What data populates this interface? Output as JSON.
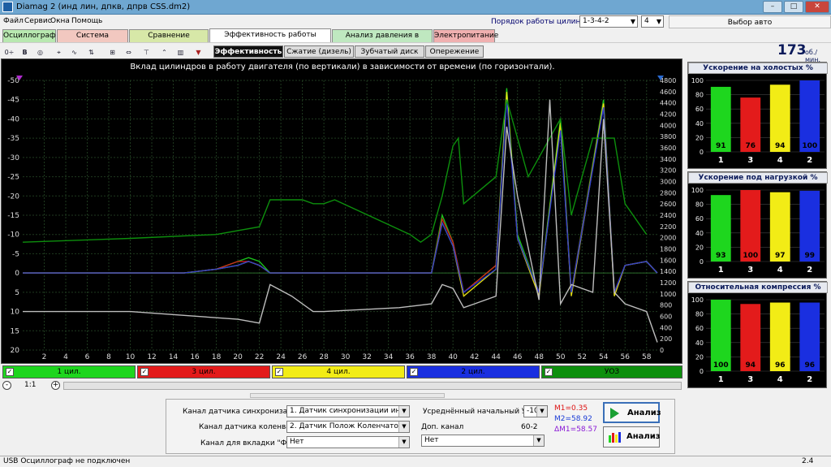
{
  "window": {
    "title": "Diamag 2 (инд лин, дпкв, дпрв CSS.dm2)"
  },
  "menu": [
    "Файл",
    "Сервис",
    "Окна",
    "Помощь"
  ],
  "header": {
    "cyl_order_label": "Порядок работы цилиндров",
    "cyl_order_value": "1-3-4-2",
    "cyl_count": "4",
    "select_car": "Выбор авто"
  },
  "tabs": [
    "Осциллограф",
    "Система зажигания",
    "Сравнение цилиндров",
    "Эффективность работы цилиндров",
    "Анализ давления в цилиндре",
    "Электропитание"
  ],
  "tab_colors": [
    "#b8e8b0",
    "#f2c8c0",
    "#d7e8a8",
    "#ffffff",
    "#bfe8c0",
    "#f0b0b0"
  ],
  "toolbar_icons": [
    "settings-icon",
    "bold-b-icon",
    "rpm-icon",
    "zoom-cursor-icon",
    "curve-icon",
    "sort-icon",
    "grid-icon",
    "scale-icon",
    "marker-icon",
    "peak-icon",
    "chart-icon",
    "filter-icon"
  ],
  "subtabs": [
    "Эффективность",
    "Сжатие (дизель)",
    "Зубчатый диск",
    "Опережение"
  ],
  "rpm": {
    "value": "173",
    "unit": "об./мин."
  },
  "scope": {
    "title": "Вклад цилиндров в работу двигателя (по вертикали) в зависимости от времени (по горизонтали)."
  },
  "cylinders": [
    {
      "label": "1 цил.",
      "color": "#1ed61e"
    },
    {
      "label": "3 цил.",
      "color": "#e31b1b"
    },
    {
      "label": "4 цил.",
      "color": "#f2ec16"
    },
    {
      "label": "2 цил.",
      "color": "#1a2fe0"
    },
    {
      "label": "УОЗ",
      "color": "#0d8f0d"
    }
  ],
  "zoom": {
    "minus": "-",
    "value": "1:1",
    "plus": "+"
  },
  "settings": {
    "sync_label": "Канал датчика синхронизации",
    "sync_value": "1. Датчик синхронизации инд. лин",
    "crank_label": "Канал датчика коленвала",
    "crank_value": "2. Датчик Полож Коленчатого Вал",
    "phase_label": "Канал для вкладки \"Фаза\"",
    "phase_value": "Нет",
    "uoz_label": "Усреднённый начальный УОЗ",
    "uoz_value": "-10",
    "add_label": "Доп. канал",
    "add_value": "Нет",
    "disc": "60-2",
    "m1": "M1=0.35",
    "m2": "M2=58.92",
    "dm": "ΔM1=58.57"
  },
  "buttons": {
    "analyze1": "Анализ",
    "analyze2": "Анализ"
  },
  "status": {
    "text": "USB Осциллограф не подключен",
    "version": "2.4"
  },
  "chart_data": [
    {
      "type": "line",
      "title": "Вклад цилиндров в работу двигателя (по вертикали) в зависимости от времени (по горизонтали).",
      "x_ticks": [
        2,
        4,
        6,
        8,
        10,
        12,
        14,
        16,
        18,
        20,
        22,
        24,
        26,
        28,
        30,
        32,
        34,
        36,
        38,
        40,
        42,
        44,
        46,
        48,
        50,
        52,
        54,
        56,
        58
      ],
      "x_range": [
        0,
        59
      ],
      "y_left_range": [
        -50,
        20
      ],
      "y_left_ticks": [
        -50,
        -45,
        -40,
        -35,
        -30,
        -25,
        -20,
        -15,
        -10,
        -5,
        0,
        5,
        10,
        15,
        20
      ],
      "y_right_range": [
        0,
        4800
      ],
      "y_right_ticks": [
        0,
        200,
        400,
        600,
        800,
        1000,
        1200,
        1400,
        1600,
        1800,
        2000,
        2200,
        2400,
        2600,
        2800,
        3000,
        3200,
        3400,
        3600,
        3800,
        4000,
        4200,
        4400,
        4600,
        4800
      ],
      "grid": true,
      "series": [
        {
          "name": "1 цил.",
          "color": "#1ed61e",
          "x": [
            0,
            5,
            10,
            15,
            18,
            20,
            21,
            22,
            23,
            24,
            30,
            38,
            39,
            40,
            41,
            44,
            45,
            46,
            48,
            50,
            51,
            54,
            55,
            56,
            58,
            59
          ],
          "y": [
            0,
            0,
            0,
            0,
            -1,
            -3,
            -4,
            -3,
            0,
            0,
            0,
            0,
            -15,
            -8,
            5,
            -2,
            -48,
            -10,
            5,
            -40,
            5,
            -45,
            5,
            -2,
            -3,
            0
          ]
        },
        {
          "name": "3 цил.",
          "color": "#e31b1b",
          "x": [
            0,
            5,
            10,
            15,
            18,
            20,
            21,
            22,
            23,
            24,
            30,
            38,
            39,
            40,
            41,
            44,
            45,
            46,
            48,
            50,
            51,
            54,
            55,
            56,
            58,
            59
          ],
          "y": [
            0,
            0,
            0,
            0,
            -1,
            -3,
            -3,
            -2,
            0,
            0,
            0,
            0,
            -14,
            -8,
            5,
            -2,
            -46,
            -9,
            5,
            -38,
            5,
            -44,
            5,
            -2,
            -3,
            0
          ]
        },
        {
          "name": "4 цил.",
          "color": "#f2ec16",
          "x": [
            0,
            5,
            10,
            15,
            18,
            20,
            21,
            22,
            23,
            24,
            30,
            38,
            39,
            40,
            41,
            44,
            45,
            46,
            48,
            50,
            51,
            54,
            55,
            56,
            58,
            59
          ],
          "y": [
            0,
            0,
            0,
            0,
            -1,
            -2,
            -3,
            -2,
            0,
            0,
            0,
            0,
            -13,
            -7,
            6,
            -1,
            -47,
            -9,
            6,
            -39,
            6,
            -44,
            6,
            -2,
            -3,
            0
          ]
        },
        {
          "name": "2 цил.",
          "color": "#1a2fe0",
          "x": [
            0,
            5,
            10,
            15,
            18,
            20,
            21,
            22,
            23,
            24,
            30,
            38,
            39,
            40,
            41,
            44,
            45,
            46,
            48,
            50,
            51,
            54,
            55,
            56,
            58,
            59
          ],
          "y": [
            0,
            0,
            0,
            0,
            -1,
            -2,
            -3,
            -2,
            0,
            0,
            0,
            0,
            -13,
            -7,
            5,
            -1,
            -45,
            -9,
            5,
            -37,
            5,
            -43,
            5,
            -2,
            -3,
            0
          ]
        },
        {
          "name": "УОЗ",
          "color": "#0d8f0d",
          "x": [
            0,
            10,
            18,
            22,
            23,
            26,
            27,
            28,
            29,
            36,
            37,
            38,
            39,
            40,
            40.5,
            41,
            44,
            45,
            46,
            47,
            50,
            51,
            53,
            55,
            56,
            58
          ],
          "y": [
            -8,
            -9,
            -10,
            -12,
            -19,
            -19,
            -18,
            -18,
            -19,
            -10,
            -8,
            -10,
            -20,
            -33,
            -35,
            -18,
            -25,
            -45,
            -35,
            -25,
            -40,
            -15,
            -35,
            -35,
            -18,
            -10
          ]
        },
        {
          "name": "",
          "color": "#bdbdbd",
          "x": [
            0,
            5,
            10,
            15,
            20,
            22,
            23,
            25,
            27,
            28,
            35,
            38,
            39,
            40,
            41,
            42,
            44,
            45,
            46,
            48,
            49,
            50,
            51,
            53,
            54,
            55,
            56,
            58,
            59
          ],
          "y": [
            10,
            10,
            10,
            11,
            12,
            13,
            3,
            6,
            10,
            10,
            9,
            8,
            3,
            4,
            9,
            8,
            6,
            -38,
            -20,
            7,
            -45,
            8,
            3,
            5,
            -40,
            5,
            8,
            10,
            18
          ]
        }
      ]
    },
    {
      "type": "bar",
      "title": "Ускорение на холостых %",
      "categories": [
        "1",
        "3",
        "4",
        "2"
      ],
      "values": [
        91,
        76,
        94,
        100
      ],
      "colors": [
        "#1ed61e",
        "#e31b1b",
        "#f2ec16",
        "#1a2fe0"
      ],
      "ylim": [
        0,
        100
      ],
      "y_ticks": [
        0,
        20,
        40,
        60,
        80,
        100
      ]
    },
    {
      "type": "bar",
      "title": "Ускорение под нагрузкой %",
      "categories": [
        "1",
        "3",
        "4",
        "2"
      ],
      "values": [
        93,
        100,
        97,
        99
      ],
      "colors": [
        "#1ed61e",
        "#e31b1b",
        "#f2ec16",
        "#1a2fe0"
      ],
      "ylim": [
        0,
        100
      ],
      "y_ticks": [
        0,
        20,
        40,
        60,
        80,
        100
      ]
    },
    {
      "type": "bar",
      "title": "Относительная компрессия %",
      "categories": [
        "1",
        "3",
        "4",
        "2"
      ],
      "values": [
        100,
        94,
        96,
        96
      ],
      "colors": [
        "#1ed61e",
        "#e31b1b",
        "#f2ec16",
        "#1a2fe0"
      ],
      "ylim": [
        0,
        100
      ],
      "y_ticks": [
        0,
        20,
        40,
        60,
        80,
        100
      ]
    }
  ]
}
